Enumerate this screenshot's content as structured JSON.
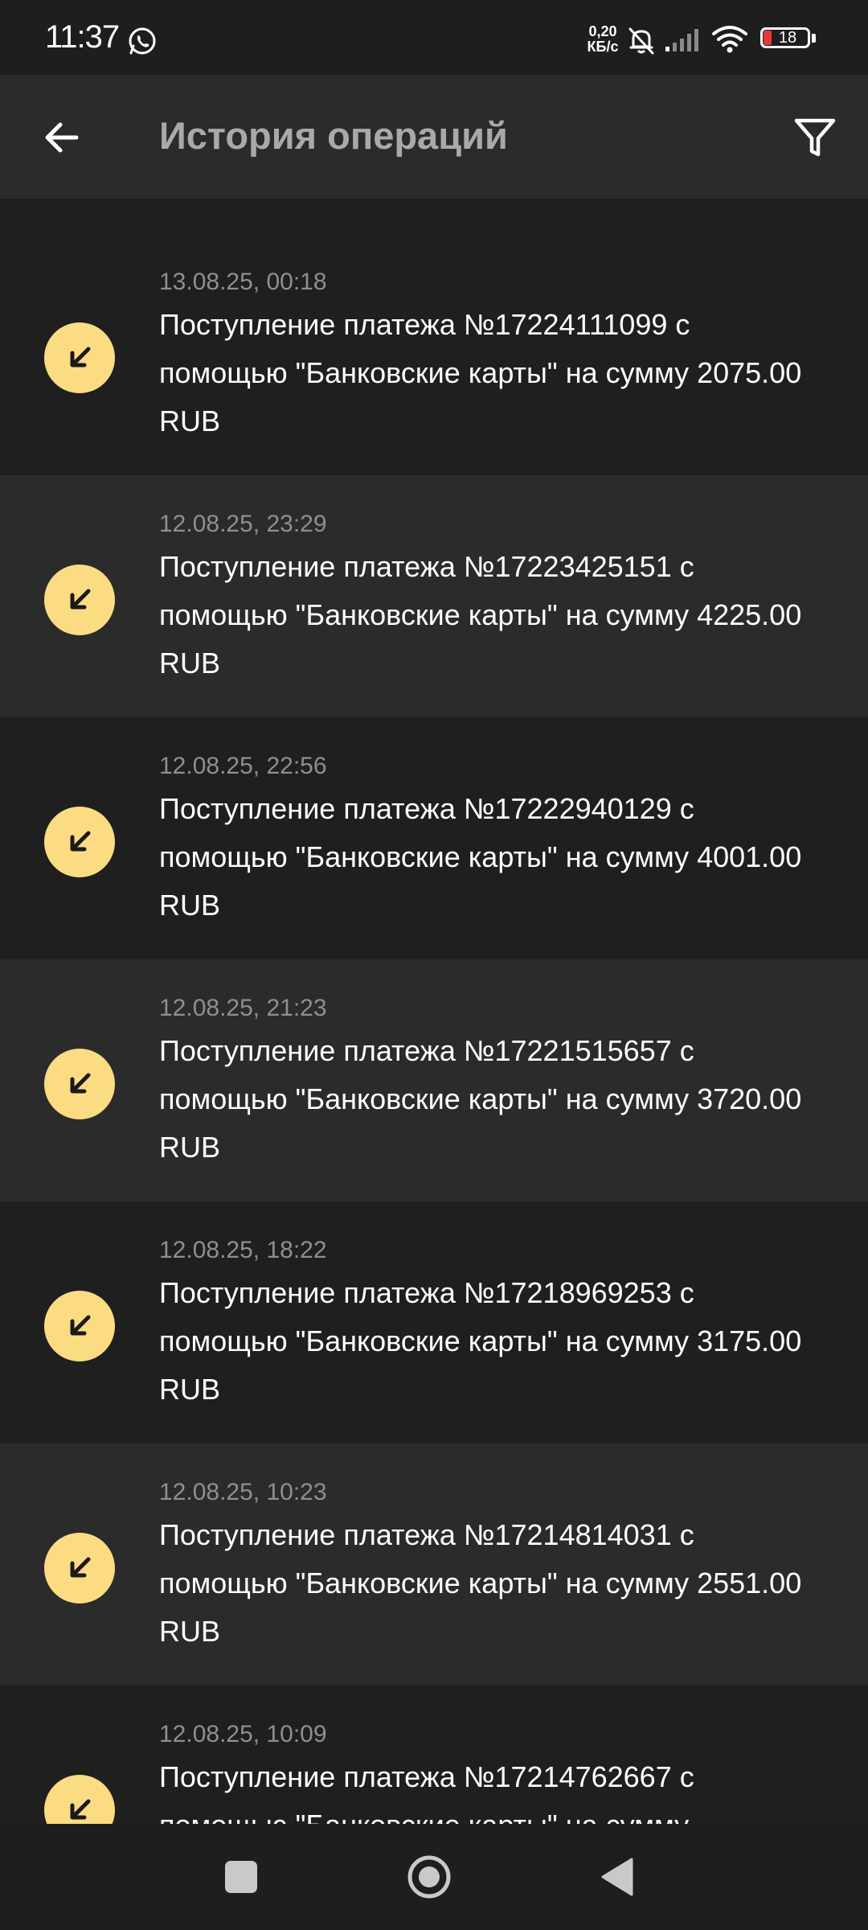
{
  "status_bar": {
    "time": "11:37",
    "net_speed_value": "0,20",
    "net_speed_unit": "КБ/с",
    "battery_level": "18",
    "icons": [
      "whatsapp-icon",
      "bell-off-icon",
      "signal-icon",
      "wifi-icon",
      "battery-icon"
    ]
  },
  "header": {
    "title": "История операций",
    "back_icon": "arrow-left-icon",
    "filter_icon": "filter-icon"
  },
  "colors": {
    "background": "#1f1f1f",
    "row_alt": "#2b2b2b",
    "accent": "#fcdc83"
  },
  "operations": [
    {
      "date": "13.08.25, 00:18",
      "description": "Поступление платежа №17224111099 с помощью \"Банковские карты\" на сумму 2075.00 RUB",
      "icon": "incoming-arrow-icon"
    },
    {
      "date": "12.08.25, 23:29",
      "description": "Поступление платежа №17223425151 с помощью \"Банковские карты\" на сумму 4225.00 RUB",
      "icon": "incoming-arrow-icon"
    },
    {
      "date": "12.08.25, 22:56",
      "description": "Поступление платежа №17222940129 с помощью \"Банковские карты\" на сумму 4001.00 RUB",
      "icon": "incoming-arrow-icon"
    },
    {
      "date": "12.08.25, 21:23",
      "description": "Поступление платежа №17221515657 с помощью \"Банковские карты\" на сумму 3720.00 RUB",
      "icon": "incoming-arrow-icon"
    },
    {
      "date": "12.08.25, 18:22",
      "description": "Поступление платежа №17218969253 с помощью \"Банковские карты\" на сумму 3175.00 RUB",
      "icon": "incoming-arrow-icon"
    },
    {
      "date": "12.08.25, 10:23",
      "description": "Поступление платежа №17214814031 с помощью \"Банковские карты\" на сумму 2551.00 RUB",
      "icon": "incoming-arrow-icon"
    },
    {
      "date": "12.08.25, 10:09",
      "description": "Поступление платежа №17214762667 с помощью \"Банковские карты\" на сумму",
      "icon": "incoming-arrow-icon"
    }
  ],
  "nav_bar": {
    "icons": [
      "recent-apps-icon",
      "home-icon",
      "back-triangle-icon"
    ]
  }
}
